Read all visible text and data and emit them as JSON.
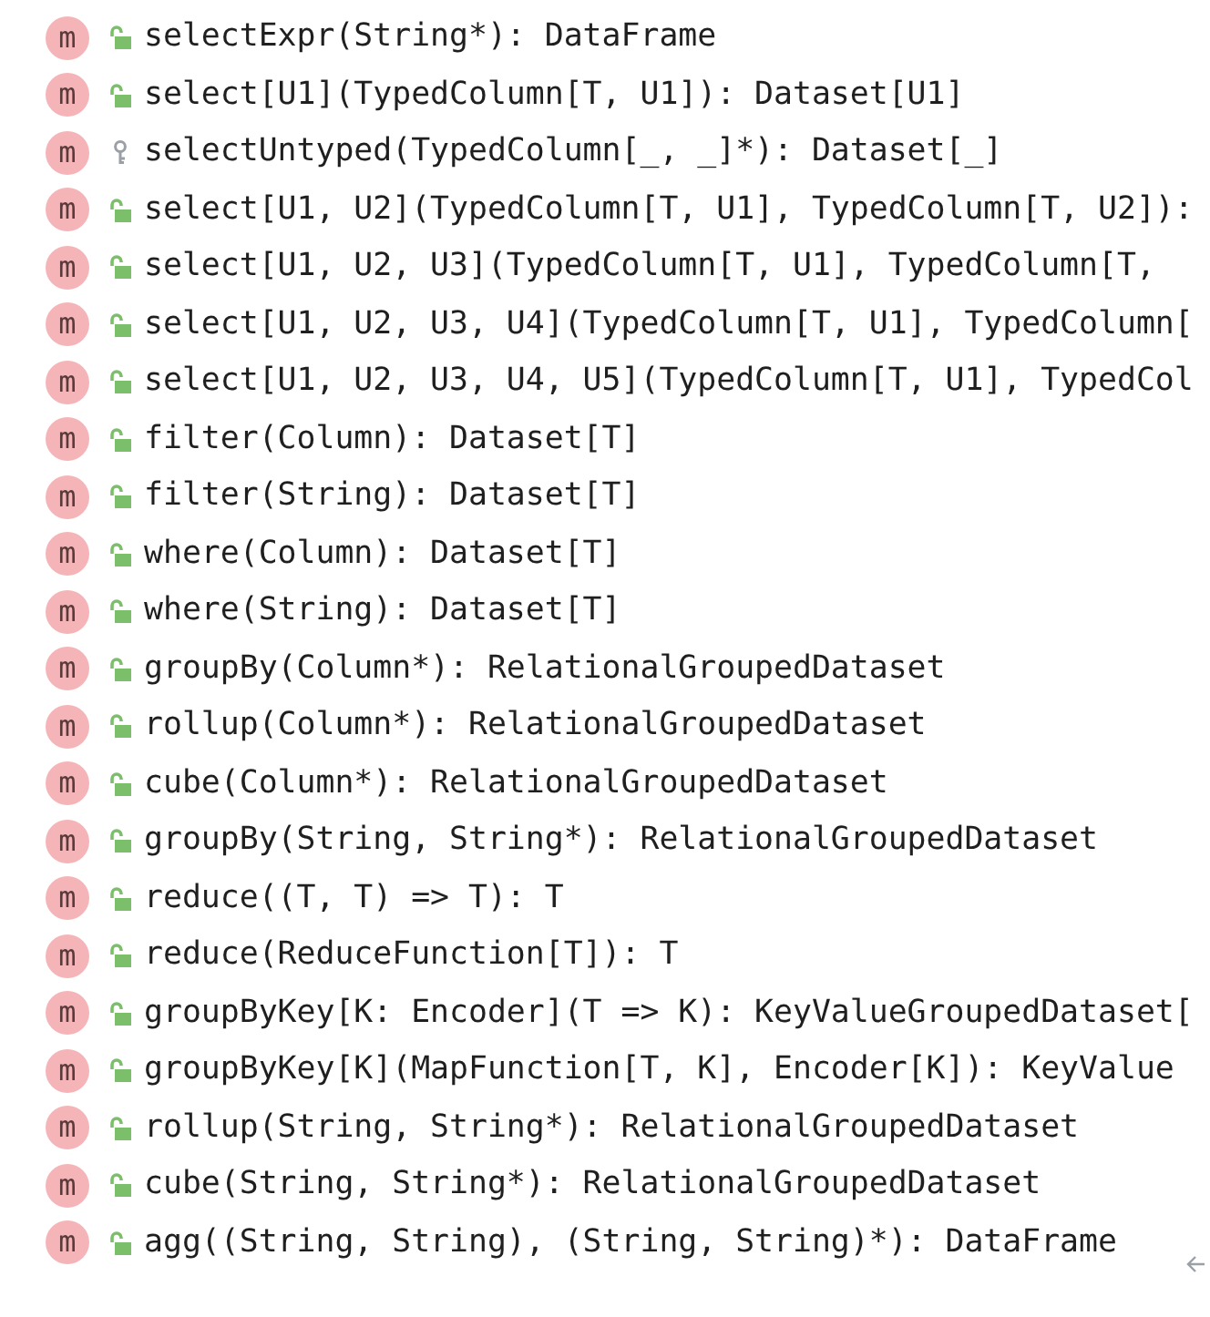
{
  "members": [
    {
      "kind": "method",
      "icon_letter": "m",
      "private": false,
      "signature": "selectExpr(String*): DataFrame"
    },
    {
      "kind": "method",
      "icon_letter": "m",
      "private": false,
      "signature": "select[U1](TypedColumn[T, U1]): Dataset[U1]"
    },
    {
      "kind": "method",
      "icon_letter": "m",
      "private": true,
      "signature": "selectUntyped(TypedColumn[_, _]*): Dataset[_]"
    },
    {
      "kind": "method",
      "icon_letter": "m",
      "private": false,
      "signature": "select[U1, U2](TypedColumn[T, U1], TypedColumn[T, U2]):"
    },
    {
      "kind": "method",
      "icon_letter": "m",
      "private": false,
      "signature": "select[U1, U2, U3](TypedColumn[T, U1], TypedColumn[T,"
    },
    {
      "kind": "method",
      "icon_letter": "m",
      "private": false,
      "signature": "select[U1, U2, U3, U4](TypedColumn[T, U1], TypedColumn["
    },
    {
      "kind": "method",
      "icon_letter": "m",
      "private": false,
      "signature": "select[U1, U2, U3, U4, U5](TypedColumn[T, U1], TypedCol"
    },
    {
      "kind": "method",
      "icon_letter": "m",
      "private": false,
      "signature": "filter(Column): Dataset[T]"
    },
    {
      "kind": "method",
      "icon_letter": "m",
      "private": false,
      "signature": "filter(String): Dataset[T]"
    },
    {
      "kind": "method",
      "icon_letter": "m",
      "private": false,
      "signature": "where(Column): Dataset[T]"
    },
    {
      "kind": "method",
      "icon_letter": "m",
      "private": false,
      "signature": "where(String): Dataset[T]"
    },
    {
      "kind": "method",
      "icon_letter": "m",
      "private": false,
      "signature": "groupBy(Column*): RelationalGroupedDataset"
    },
    {
      "kind": "method",
      "icon_letter": "m",
      "private": false,
      "signature": "rollup(Column*): RelationalGroupedDataset"
    },
    {
      "kind": "method",
      "icon_letter": "m",
      "private": false,
      "signature": "cube(Column*): RelationalGroupedDataset"
    },
    {
      "kind": "method",
      "icon_letter": "m",
      "private": false,
      "signature": "groupBy(String, String*): RelationalGroupedDataset"
    },
    {
      "kind": "method",
      "icon_letter": "m",
      "private": false,
      "signature": "reduce((T, T) => T): T"
    },
    {
      "kind": "method",
      "icon_letter": "m",
      "private": false,
      "signature": "reduce(ReduceFunction[T]): T"
    },
    {
      "kind": "method",
      "icon_letter": "m",
      "private": false,
      "signature": "groupByKey[K: Encoder](T => K): KeyValueGroupedDataset["
    },
    {
      "kind": "method",
      "icon_letter": "m",
      "private": false,
      "signature": "groupByKey[K](MapFunction[T, K], Encoder[K]): KeyValue"
    },
    {
      "kind": "method",
      "icon_letter": "m",
      "private": false,
      "signature": "rollup(String, String*): RelationalGroupedDataset"
    },
    {
      "kind": "method",
      "icon_letter": "m",
      "private": false,
      "signature": "cube(String, String*): RelationalGroupedDataset"
    },
    {
      "kind": "method",
      "icon_letter": "m",
      "private": false,
      "signature": "agg((String, String), (String, String)*): DataFrame"
    }
  ]
}
